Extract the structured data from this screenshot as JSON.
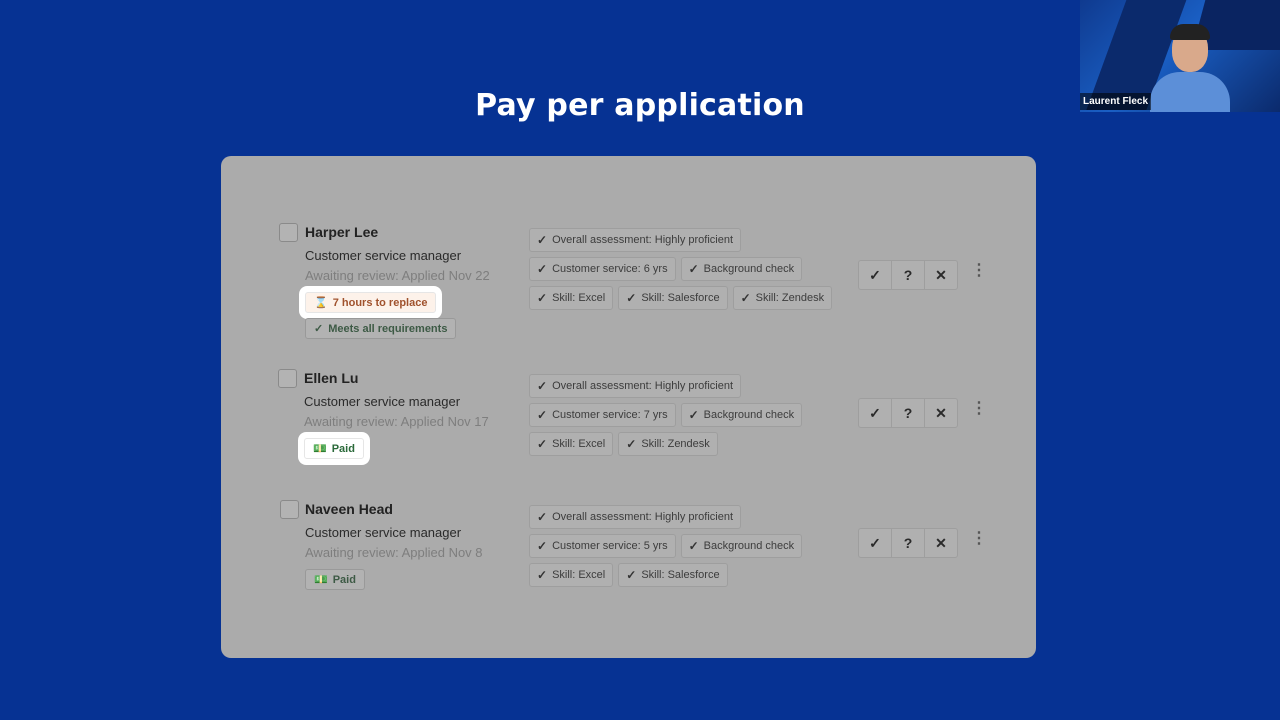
{
  "slide": {
    "title": "Pay per application"
  },
  "video": {
    "participant_name": "Laurent Fleck"
  },
  "actions": {
    "approve": "✓",
    "maybe": "?",
    "reject": "✕",
    "more": "⋮"
  },
  "candidates": [
    {
      "name": "Harper Lee",
      "job": "Customer service manager",
      "status": "Awaiting review: Applied Nov 22",
      "badges": [
        {
          "icon": "hourglass-icon",
          "glyph": "⌛",
          "label": "7 hours to replace"
        },
        {
          "icon": "check-icon",
          "glyph": "✓",
          "label": "Meets all requirements"
        }
      ],
      "tags": [
        "Overall assessment: Highly proficient",
        "Customer service: 6 yrs",
        "Background check",
        "Skill: Excel",
        "Skill: Salesforce",
        "Skill: Zendesk"
      ]
    },
    {
      "name": "Ellen Lu",
      "job": "Customer service manager",
      "status": "Awaiting review: Applied Nov 17",
      "badges": [
        {
          "icon": "money-icon",
          "glyph": "💵",
          "label": "Paid"
        }
      ],
      "tags": [
        "Overall assessment: Highly proficient",
        "Customer service: 7 yrs",
        "Background check",
        "Skill: Excel",
        "Skill: Zendesk"
      ]
    },
    {
      "name": "Naveen Head",
      "job": "Customer service manager",
      "status": "Awaiting review: Applied Nov 8",
      "badges": [
        {
          "icon": "money-icon",
          "glyph": "💵",
          "label": "Paid"
        }
      ],
      "tags": [
        "Overall assessment: Highly proficient",
        "Customer service: 5 yrs",
        "Background check",
        "Skill: Excel",
        "Skill: Salesforce"
      ]
    }
  ],
  "colors": {
    "background": "#063293",
    "card": "#ababab",
    "highlight_orange": "#a0522d",
    "paid_green": "#2b6a3a"
  }
}
